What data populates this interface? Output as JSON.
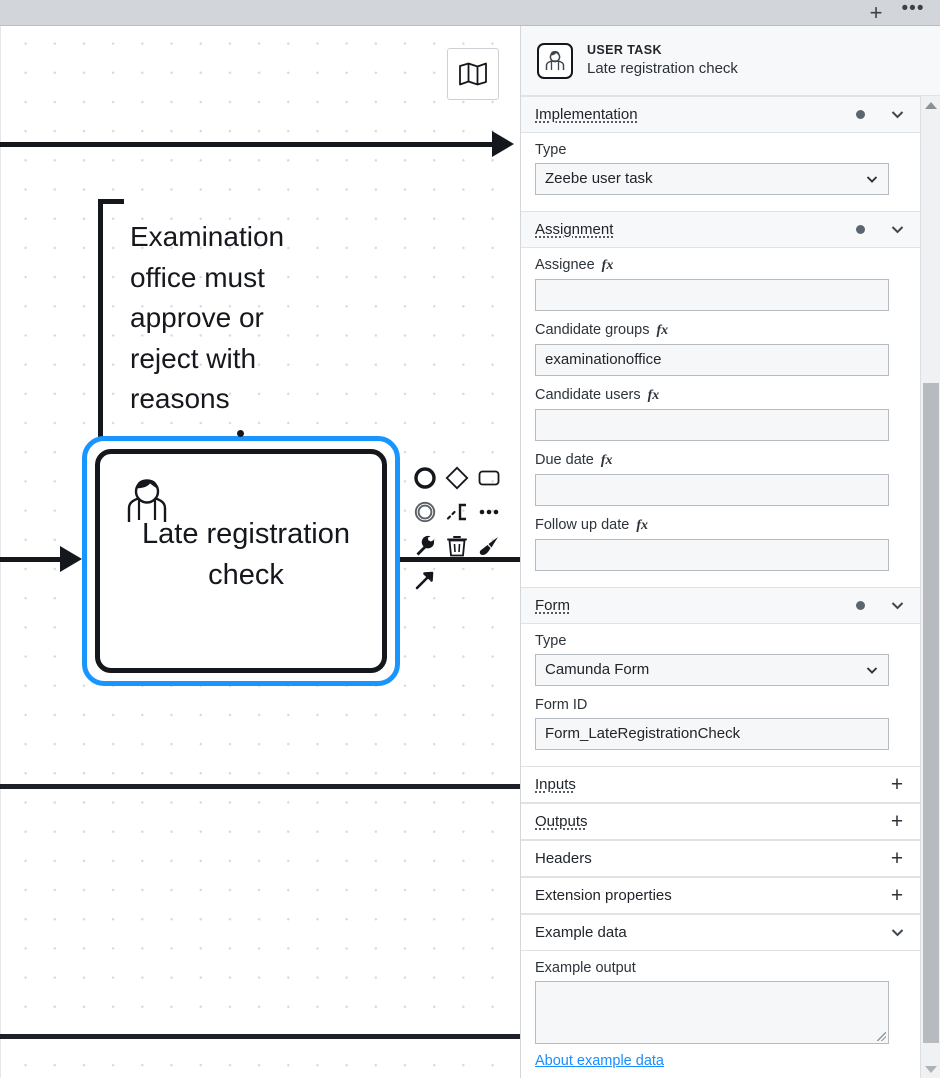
{
  "topbar": {
    "add_label": "+",
    "more_label": "•••"
  },
  "canvas": {
    "minimap_tooltip": "Toggle minimap",
    "annotation_text": "Examination office must approve or reject with reasons",
    "task": {
      "name": "Late registration check",
      "type": "User Task"
    },
    "context_pad": [
      {
        "name": "append-end-event",
        "label": "Append EndEvent"
      },
      {
        "name": "append-gateway",
        "label": "Append Gateway"
      },
      {
        "name": "append-task",
        "label": "Append Task"
      },
      {
        "name": "append-intermediate-event",
        "label": "Append Intermediate/Boundary Event"
      },
      {
        "name": "append-text-annotation",
        "label": "Append TextAnnotation"
      },
      {
        "name": "append-more",
        "label": "Append element"
      },
      {
        "name": "change-type",
        "label": "Change element"
      },
      {
        "name": "delete",
        "label": "Remove"
      },
      {
        "name": "set-color",
        "label": "Set color"
      },
      {
        "name": "connect",
        "label": "Connect to other element"
      }
    ]
  },
  "panel": {
    "header": {
      "type": "USER TASK",
      "name": "Late registration  check",
      "icon": "user-task-icon"
    },
    "groups": [
      {
        "id": "implementation",
        "title": "Implementation",
        "has_dot": true,
        "collapsible": true,
        "fields": [
          {
            "kind": "select",
            "label": "Type",
            "value": "Zeebe user task"
          }
        ]
      },
      {
        "id": "assignment",
        "title": "Assignment",
        "has_dot": true,
        "collapsible": true,
        "fields": [
          {
            "kind": "input",
            "label": "Assignee",
            "fx": "fx",
            "value": "",
            "placeholder": ""
          },
          {
            "kind": "input",
            "label": "Candidate groups",
            "fx": "fx",
            "value": "examinationoffice",
            "placeholder": ""
          },
          {
            "kind": "input",
            "label": "Candidate users",
            "fx": "fx",
            "value": "",
            "placeholder": ""
          },
          {
            "kind": "input",
            "label": "Due date",
            "fx": "fx",
            "value": "",
            "placeholder": ""
          },
          {
            "kind": "input",
            "label": "Follow up date",
            "fx": "fx",
            "value": "",
            "placeholder": ""
          }
        ]
      },
      {
        "id": "form",
        "title": "Form",
        "has_dot": true,
        "collapsible": true,
        "fields": [
          {
            "kind": "select",
            "label": "Type",
            "value": "Camunda Form"
          },
          {
            "kind": "input",
            "label": "Form ID",
            "value": "Form_LateRegistrationCheck",
            "placeholder": ""
          }
        ]
      }
    ],
    "add_groups": [
      {
        "id": "inputs",
        "title": "Inputs",
        "add_label": "+",
        "dotted": true
      },
      {
        "id": "outputs",
        "title": "Outputs",
        "add_label": "+",
        "dotted": true
      },
      {
        "id": "headers",
        "title": "Headers",
        "add_label": "+",
        "dotted": false
      },
      {
        "id": "extension-properties",
        "title": "Extension properties",
        "add_label": "+",
        "dotted": false
      }
    ],
    "example_data": {
      "title": "Example data",
      "output_label": "Example output",
      "output_value": "",
      "link_label": "About example data"
    }
  },
  "colors": {
    "selection": "#1895ff",
    "link": "#1a8dff",
    "shape_stroke": "#14171c",
    "panel_bg": "#ffffff",
    "group_header_bg": "#f7f8f9",
    "topbar_bg": "#d2d5da"
  }
}
